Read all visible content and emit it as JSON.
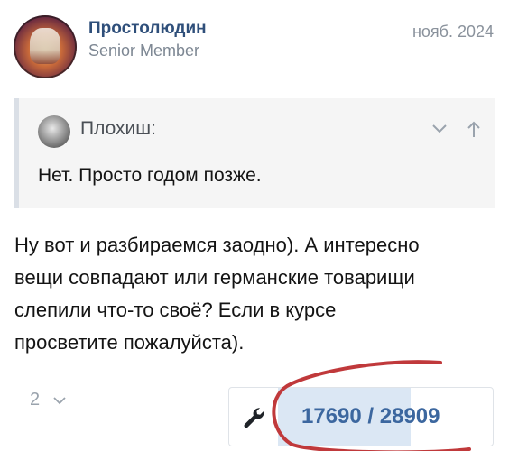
{
  "post": {
    "author": "Простолюдин",
    "author_title": "Senior Member",
    "date": "нояб. 2024"
  },
  "quote": {
    "author": "Плохиш:",
    "text": "Нет. Просто годом позже.",
    "icons": [
      "chevron-down-icon",
      "arrow-up-icon"
    ]
  },
  "body": {
    "lines": [
      "Ну вот и разбираемся заодно). А интересно",
      "вещи совпадают или германские товарищи",
      "слепили что-то своё? Если в курсе",
      "просветите пожалуйста)."
    ]
  },
  "reactions": {
    "count": "2"
  },
  "pager": {
    "icon": "wrench-icon",
    "text": "17690 / 28909",
    "progress": 0.612
  },
  "colors": {
    "author": "#2f4f7a",
    "pager_text": "#3c679f",
    "pager_fill": "#dbe7f4",
    "annotation": "#c0393b"
  }
}
